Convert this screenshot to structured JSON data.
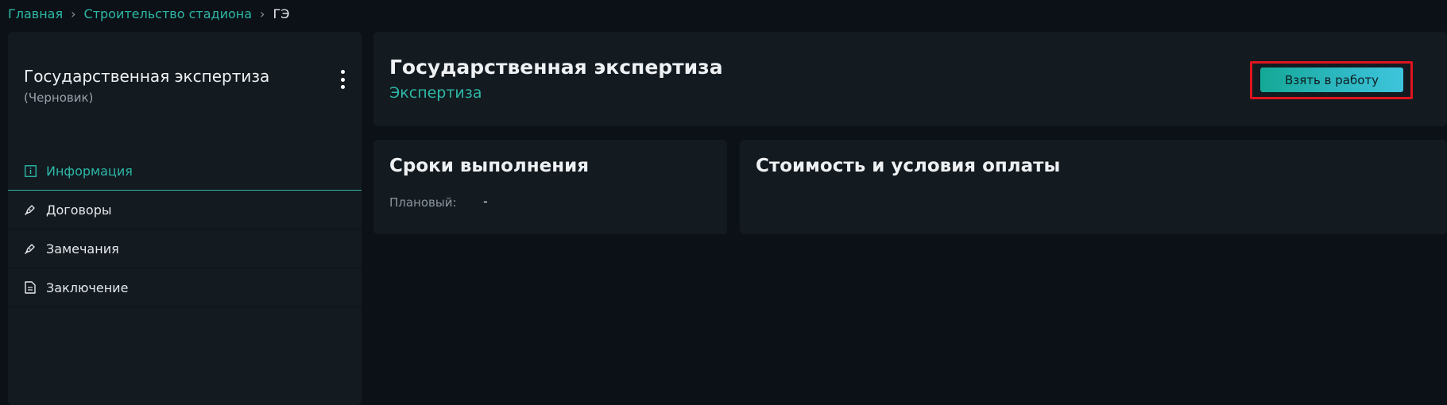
{
  "breadcrumb": {
    "items": [
      "Главная",
      "Строительство стадиона"
    ],
    "current": "ГЭ",
    "separator": "›"
  },
  "sidebar": {
    "title": "Государственная экспертиза",
    "status": "(Черновик)",
    "menu_icon": "kebab-menu-icon",
    "items": [
      {
        "label": "Информация",
        "icon": "info-icon",
        "active": true
      },
      {
        "label": "Договоры",
        "icon": "pen-icon",
        "active": false
      },
      {
        "label": "Замечания",
        "icon": "pen-icon",
        "active": false
      },
      {
        "label": "Заключение",
        "icon": "document-icon",
        "active": false
      }
    ]
  },
  "main": {
    "title": "Государственная экспертиза",
    "subtitle": "Экспертиза",
    "take_button_label": "Взять в работу"
  },
  "deadlines": {
    "title": "Сроки выполнения",
    "planned_label": "Плановый:",
    "planned_value": "-"
  },
  "cost": {
    "title": "Стоимость и условия оплаты"
  },
  "colors": {
    "accent": "#2db8a6",
    "highlight": "#e0141e",
    "background": "#0c1117",
    "card": "#131a20"
  }
}
